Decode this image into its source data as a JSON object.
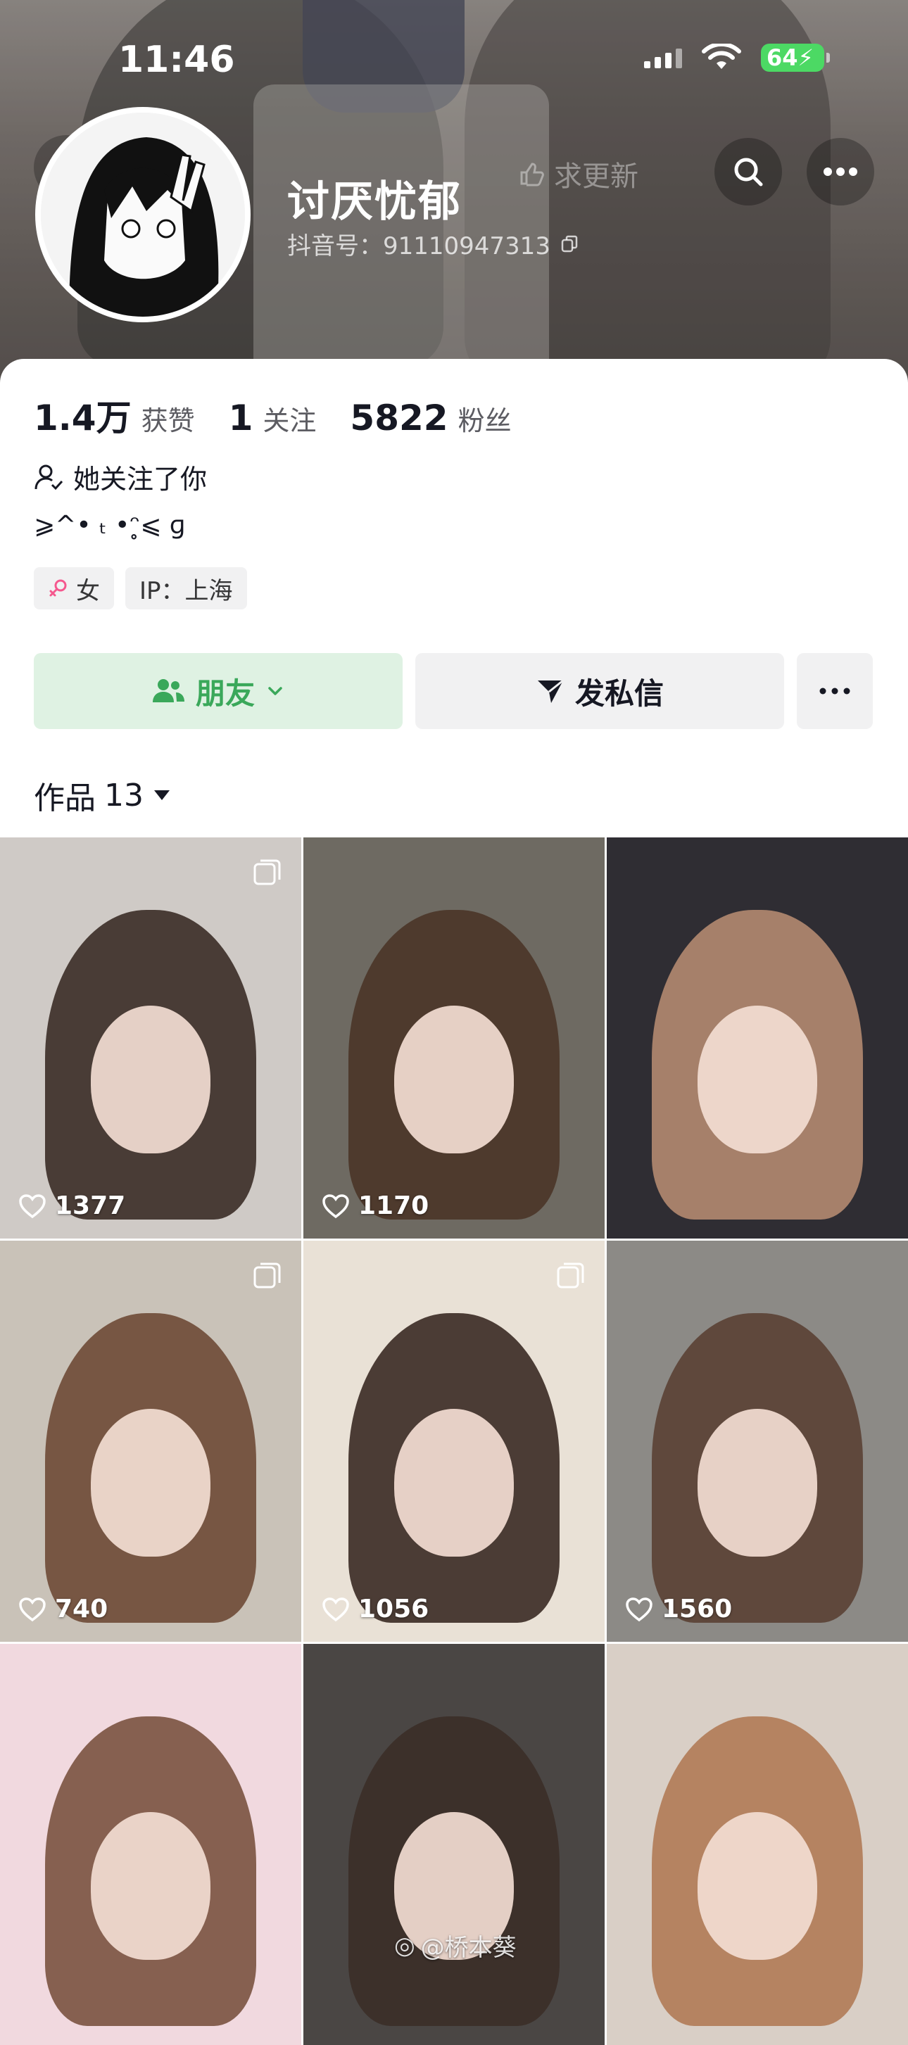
{
  "status_bar": {
    "time": "11:46",
    "battery": "64"
  },
  "profile": {
    "nickname": "讨厌忧郁",
    "douyin_id": "抖音号：91110947313",
    "update_hint": "求更新"
  },
  "stats": [
    {
      "num": "1.4万",
      "label": "获赞"
    },
    {
      "num": "1",
      "label": "关注"
    },
    {
      "num": "5822",
      "label": "粉丝"
    }
  ],
  "follows_you": "她关注了你",
  "signature": "⩾^• ₜ •ᵔ̥⩽ ɡ",
  "tags": {
    "gender": "女",
    "ip": "IP：上海"
  },
  "actions": {
    "friend": "朋友",
    "message": "发私信"
  },
  "works_tab": {
    "label": "作品",
    "count": "13"
  },
  "videos": [
    {
      "likes": "1377",
      "multi": true,
      "bg": "#cfcac6",
      "hair": "#3a2c26"
    },
    {
      "likes": "1170",
      "multi": false,
      "bg": "#6e6a62",
      "hair": "#4a3528"
    },
    {
      "likes": "",
      "multi": false,
      "bg": "#2f2d33",
      "hair": "#b48a70"
    },
    {
      "likes": "740",
      "multi": true,
      "bg": "#c9c2b8",
      "hair": "#6e4a36"
    },
    {
      "likes": "1056",
      "multi": true,
      "bg": "#e9e1d6",
      "hair": "#3a2a24"
    },
    {
      "likes": "1560",
      "multi": false,
      "bg": "#8c8a86",
      "hair": "#5a4034"
    },
    {
      "likes": "",
      "multi": false,
      "bg": "#f1d9df",
      "hair": "#7a5240"
    },
    {
      "likes": "",
      "multi": false,
      "bg": "#4a4644",
      "hair": "#3b2d28"
    },
    {
      "likes": "",
      "multi": false,
      "bg": "#d9cfc6",
      "hair": "#b07a55"
    }
  ],
  "watermark": "@桥本葵"
}
